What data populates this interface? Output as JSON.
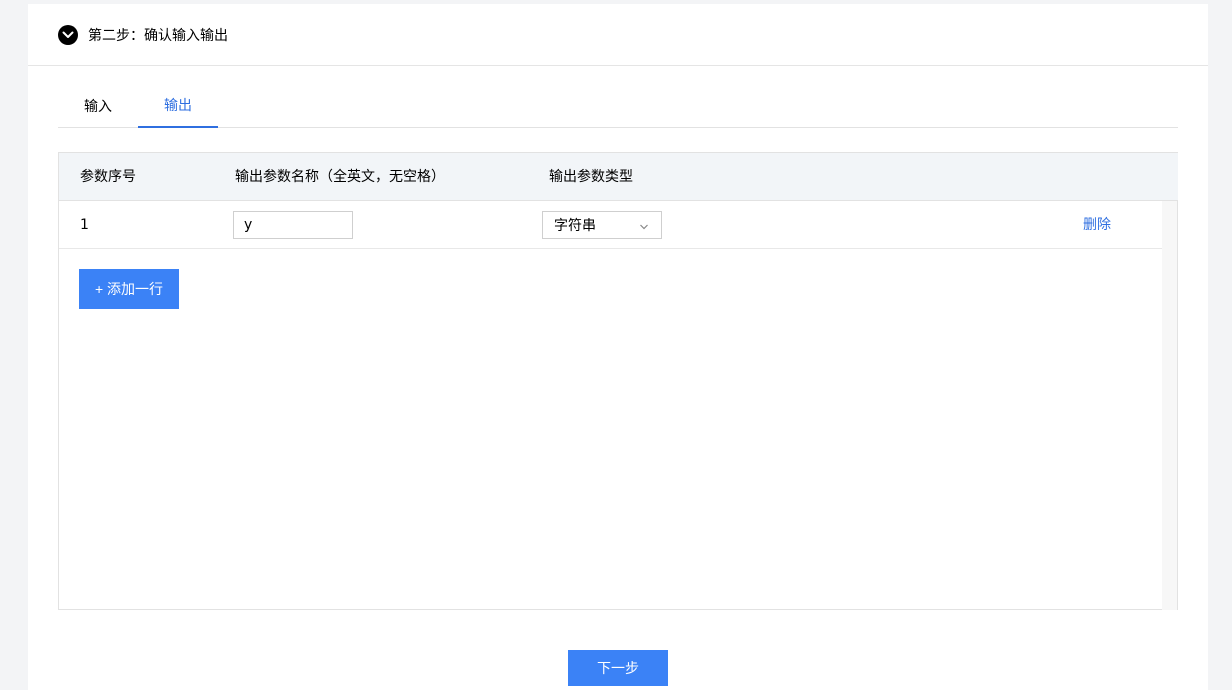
{
  "step": {
    "title": "第二步：确认输入输出",
    "icon": "chevron-down-circle-icon"
  },
  "tabs": [
    {
      "label": "输入",
      "active": false
    },
    {
      "label": "输出",
      "active": true
    }
  ],
  "table": {
    "columns": [
      "参数序号",
      "输出参数名称（全英文，无空格）",
      "输出参数类型"
    ],
    "rows": [
      {
        "index": "1",
        "name": "y",
        "type": "字符串",
        "action": "删除"
      }
    ]
  },
  "add_row_button": "+ 添加一行",
  "next_button": "下一步",
  "colors": {
    "accent": "#3b82f6",
    "link": "#2f6fe0",
    "header_bg": "#f2f5f8"
  }
}
